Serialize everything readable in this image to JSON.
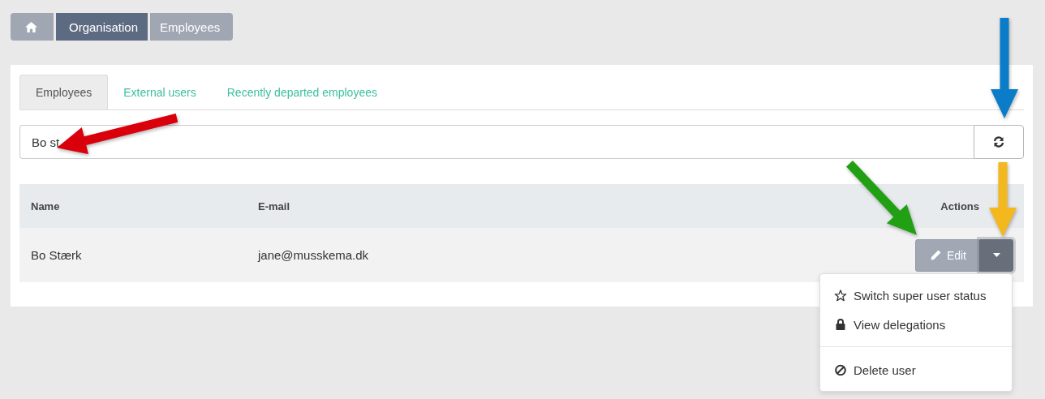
{
  "breadcrumb": [
    {
      "kind": "home"
    },
    {
      "kind": "link",
      "label": "Organisation"
    },
    {
      "kind": "current",
      "label": "Employees"
    }
  ],
  "tabs": [
    {
      "label": "Employees",
      "selected": true
    },
    {
      "label": "External users",
      "selected": false
    },
    {
      "label": "Recently departed employees",
      "selected": false
    }
  ],
  "search": {
    "value": "Bo st"
  },
  "table": {
    "columns": [
      "Name",
      "E-mail",
      "Actions"
    ],
    "rows": [
      {
        "name": "Bo Stærk",
        "email": "jane@musskema.dk",
        "edit_label": "Edit"
      }
    ]
  },
  "menu": {
    "open": true,
    "items": [
      {
        "kind": "star",
        "label": "Switch super user status"
      },
      {
        "kind": "lock",
        "label": "View delegations"
      },
      {
        "kind": "divider"
      },
      {
        "kind": "ban",
        "label": "Delete user"
      }
    ]
  }
}
